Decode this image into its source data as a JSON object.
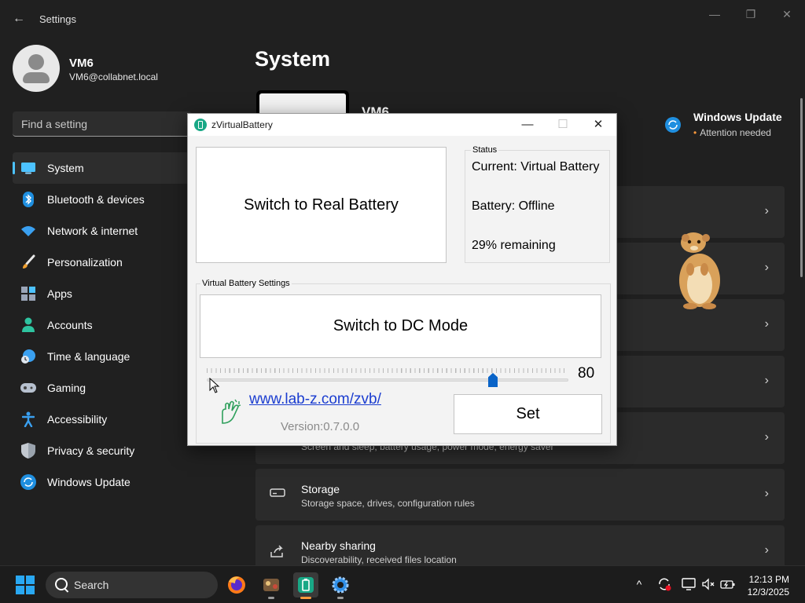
{
  "settings": {
    "app_title": "Settings",
    "back_glyph": "←",
    "window_controls": {
      "minimize": "—",
      "maximize": "❐",
      "close": "✕"
    },
    "profile": {
      "name": "VM6",
      "email": "VM6@collabnet.local",
      "icon": "user-avatar-icon"
    },
    "search_placeholder": "Find a setting",
    "nav": [
      {
        "label": "System",
        "icon": "monitor-icon",
        "active": true
      },
      {
        "label": "Bluetooth & devices",
        "icon": "bluetooth-icon"
      },
      {
        "label": "Network & internet",
        "icon": "wifi-icon"
      },
      {
        "label": "Personalization",
        "icon": "brush-icon"
      },
      {
        "label": "Apps",
        "icon": "apps-icon"
      },
      {
        "label": "Accounts",
        "icon": "person-icon"
      },
      {
        "label": "Time & language",
        "icon": "globe-clock-icon"
      },
      {
        "label": "Gaming",
        "icon": "gamepad-icon"
      },
      {
        "label": "Accessibility",
        "icon": "accessibility-icon"
      },
      {
        "label": "Privacy & security",
        "icon": "shield-icon"
      },
      {
        "label": "Windows Update",
        "icon": "refresh-icon"
      }
    ],
    "page_title": "System",
    "device_name": "VM6",
    "windows_update": {
      "title": "Windows Update",
      "subtitle": "Attention needed",
      "icon": "refresh-icon"
    },
    "cards": [
      {
        "title": "",
        "subtitle": ""
      },
      {
        "title": "",
        "subtitle": ""
      },
      {
        "title": "",
        "subtitle": ""
      },
      {
        "title": "",
        "subtitle": ""
      },
      {
        "title": "",
        "subtitle": "Screen and sleep, battery usage, power mode, energy saver"
      },
      {
        "title": "Storage",
        "subtitle": "Storage space, drives, configuration rules",
        "icon": "storage-icon"
      },
      {
        "title": "Nearby sharing",
        "subtitle": "Discoverability, received files location",
        "icon": "share-icon"
      }
    ],
    "chevron": "›"
  },
  "dialog": {
    "title": "zVirtualBattery",
    "controls": {
      "minimize": "—",
      "maximize": "☐",
      "close": "✕"
    },
    "switch_real_label": "Switch to Real Battery",
    "status": {
      "legend": "Status",
      "current": "Current: Virtual Battery",
      "battery": "Battery: Offline",
      "remaining": "29% remaining"
    },
    "vbs_legend": "Virtual Battery Settings",
    "switch_dc_label": "Switch to DC Mode",
    "slider": {
      "value": "80",
      "min": 0,
      "max": 100
    },
    "link": "www.lab-z.com/zvb/",
    "version": "Version:0.7.0.0",
    "set_label": "Set"
  },
  "taskbar": {
    "search_label": "Search",
    "apps": [
      {
        "name": "firefox",
        "icon": "firefox-icon"
      },
      {
        "name": "game",
        "icon": "game-app-icon"
      },
      {
        "name": "zvirtualbattery",
        "icon": "battery-app-icon",
        "active": true
      },
      {
        "name": "settings",
        "icon": "gear-icon"
      }
    ],
    "tray": {
      "chevron": "^"
    },
    "clock": {
      "time": "12:13 PM",
      "date": "12/3/2025"
    }
  },
  "colors": {
    "accent": "#4cc2ff",
    "settings_bg": "#202020",
    "card_bg": "#2b2b2b",
    "dialog_bg": "#f3f3f3",
    "link": "#1b3dd0",
    "slider_thumb": "#0a64c8",
    "update_dot": "#ff9a3c"
  }
}
